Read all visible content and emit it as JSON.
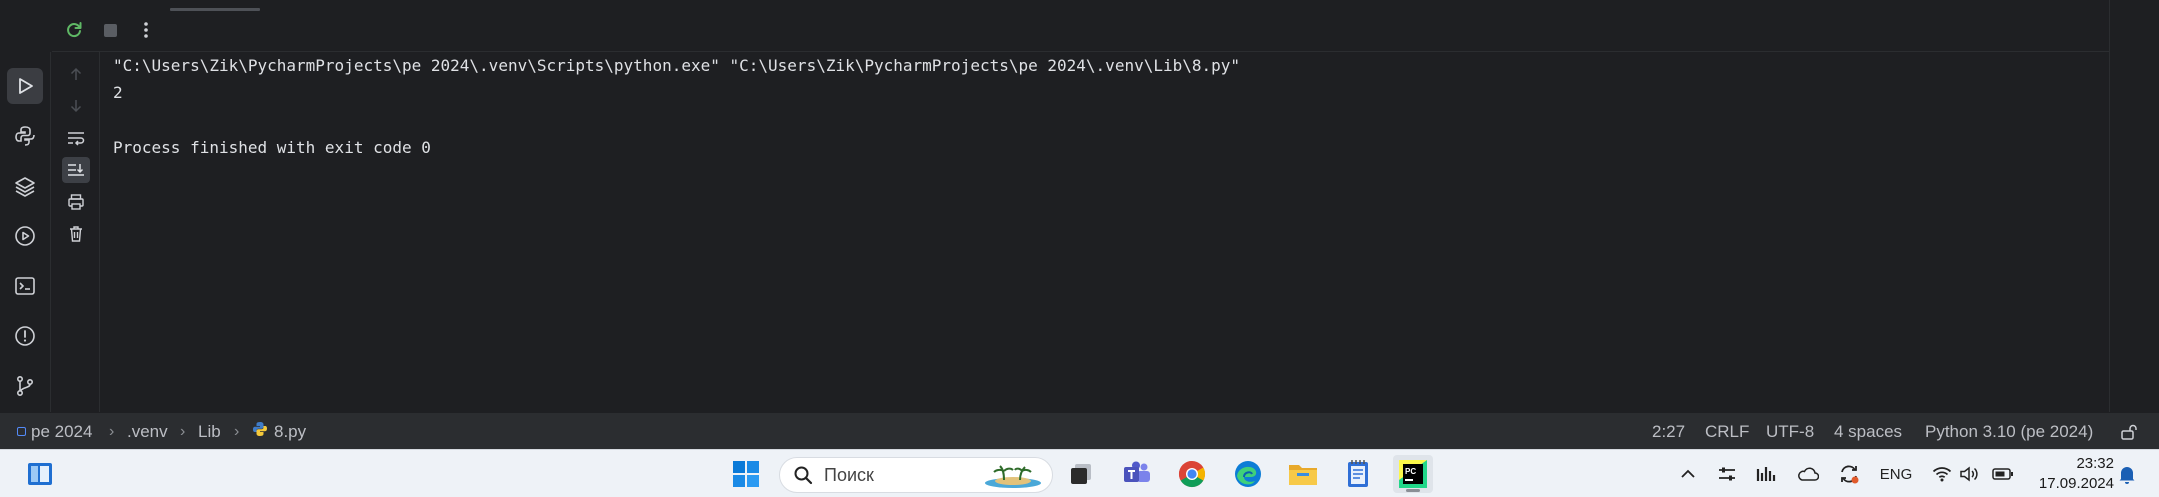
{
  "console": {
    "lines": [
      "\"C:\\Users\\Zik\\PycharmProjects\\pe 2024\\.venv\\Scripts\\python.exe\" \"C:\\Users\\Zik\\PycharmProjects\\pe 2024\\.venv\\Lib\\8.py\"",
      "2",
      "",
      "Process finished with exit code 0"
    ]
  },
  "breadcrumb": {
    "items": [
      "pe 2024",
      ".venv",
      "Lib",
      "8.py"
    ]
  },
  "status": {
    "position": "2:27",
    "line_separator": "CRLF",
    "encoding": "UTF-8",
    "indent": "4 spaces",
    "interpreter": "Python 3.10 (pe 2024)"
  },
  "taskbar": {
    "search_placeholder": "Поиск",
    "language": "ENG",
    "time": "23:32",
    "date": "17.09.2024"
  },
  "colors": {
    "ide_bg": "#1e1f22",
    "statusbar_bg": "#2b2d30",
    "rerun_green": "#5fb865",
    "taskbar_bg": "#eef2f7",
    "windows_blue": "#0a7ad8"
  }
}
